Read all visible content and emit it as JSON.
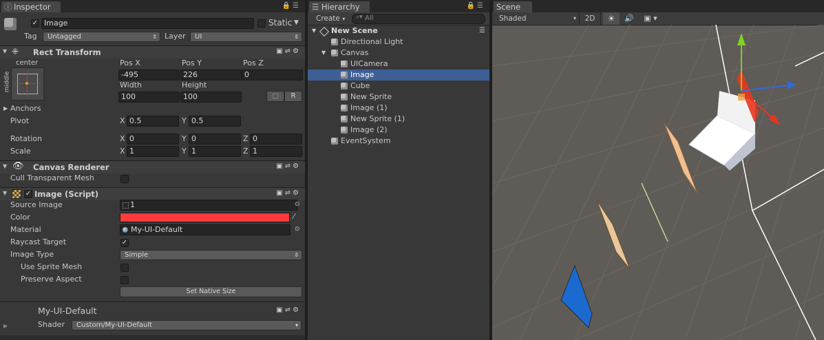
{
  "inspector": {
    "tab": "Inspector",
    "object_name": "Image",
    "static_label": "Static",
    "tag_label": "Tag",
    "tag_value": "Untagged",
    "layer_label": "Layer",
    "layer_value": "UI",
    "rect_transform": {
      "title": "Rect Transform",
      "anchor_h": "center",
      "anchor_v": "middle",
      "pos_x_label": "Pos X",
      "pos_y_label": "Pos Y",
      "pos_z_label": "Pos Z",
      "pos_x": "-495",
      "pos_y": "226",
      "pos_z": "0",
      "width_label": "Width",
      "height_label": "Height",
      "width": "100",
      "height": "100",
      "raw_button": "R",
      "anchors_label": "Anchors",
      "pivot_label": "Pivot",
      "pivot_x": "0.5",
      "pivot_y": "0.5",
      "rotation_label": "Rotation",
      "rot_x": "0",
      "rot_y": "0",
      "rot_z": "0",
      "scale_label": "Scale",
      "scale_x": "1",
      "scale_y": "1",
      "scale_z": "1",
      "x": "X",
      "y": "Y",
      "z": "Z"
    },
    "canvas_renderer": {
      "title": "Canvas Renderer",
      "cull_label": "Cull Transparent Mesh"
    },
    "image_script": {
      "title": "Image (Script)",
      "source_image_label": "Source Image",
      "source_image_value": "1",
      "color_label": "Color",
      "color_value": "#ff3b3b",
      "material_label": "Material",
      "material_value": "My-UI-Default",
      "raycast_label": "Raycast Target",
      "image_type_label": "Image Type",
      "image_type_value": "Simple",
      "use_sprite_mesh_label": "Use Sprite Mesh",
      "preserve_aspect_label": "Preserve Aspect",
      "set_native_size": "Set Native Size"
    },
    "material_section": {
      "name": "My-UI-Default",
      "shader_label": "Shader",
      "shader_value": "Custom/My-UI-Default"
    }
  },
  "hierarchy": {
    "tab": "Hierarchy",
    "create_label": "Create",
    "search_placeholder": "All",
    "scene_name": "New Scene",
    "items": [
      {
        "label": "Directional Light"
      },
      {
        "label": "Canvas"
      },
      {
        "label": "UICamera"
      },
      {
        "label": "Image"
      },
      {
        "label": "Cube"
      },
      {
        "label": "New Sprite"
      },
      {
        "label": "Image (1)"
      },
      {
        "label": "New Sprite (1)"
      },
      {
        "label": "Image (2)"
      },
      {
        "label": "EventSystem"
      }
    ]
  },
  "scene": {
    "tab": "Scene",
    "shading": "Shaded",
    "mode_2d": "2D"
  },
  "colors": {
    "selection": "#3e5f96",
    "gizmo_x": "#e8361e",
    "gizmo_y": "#7ed321",
    "gizmo_z": "#2f6bdc"
  }
}
